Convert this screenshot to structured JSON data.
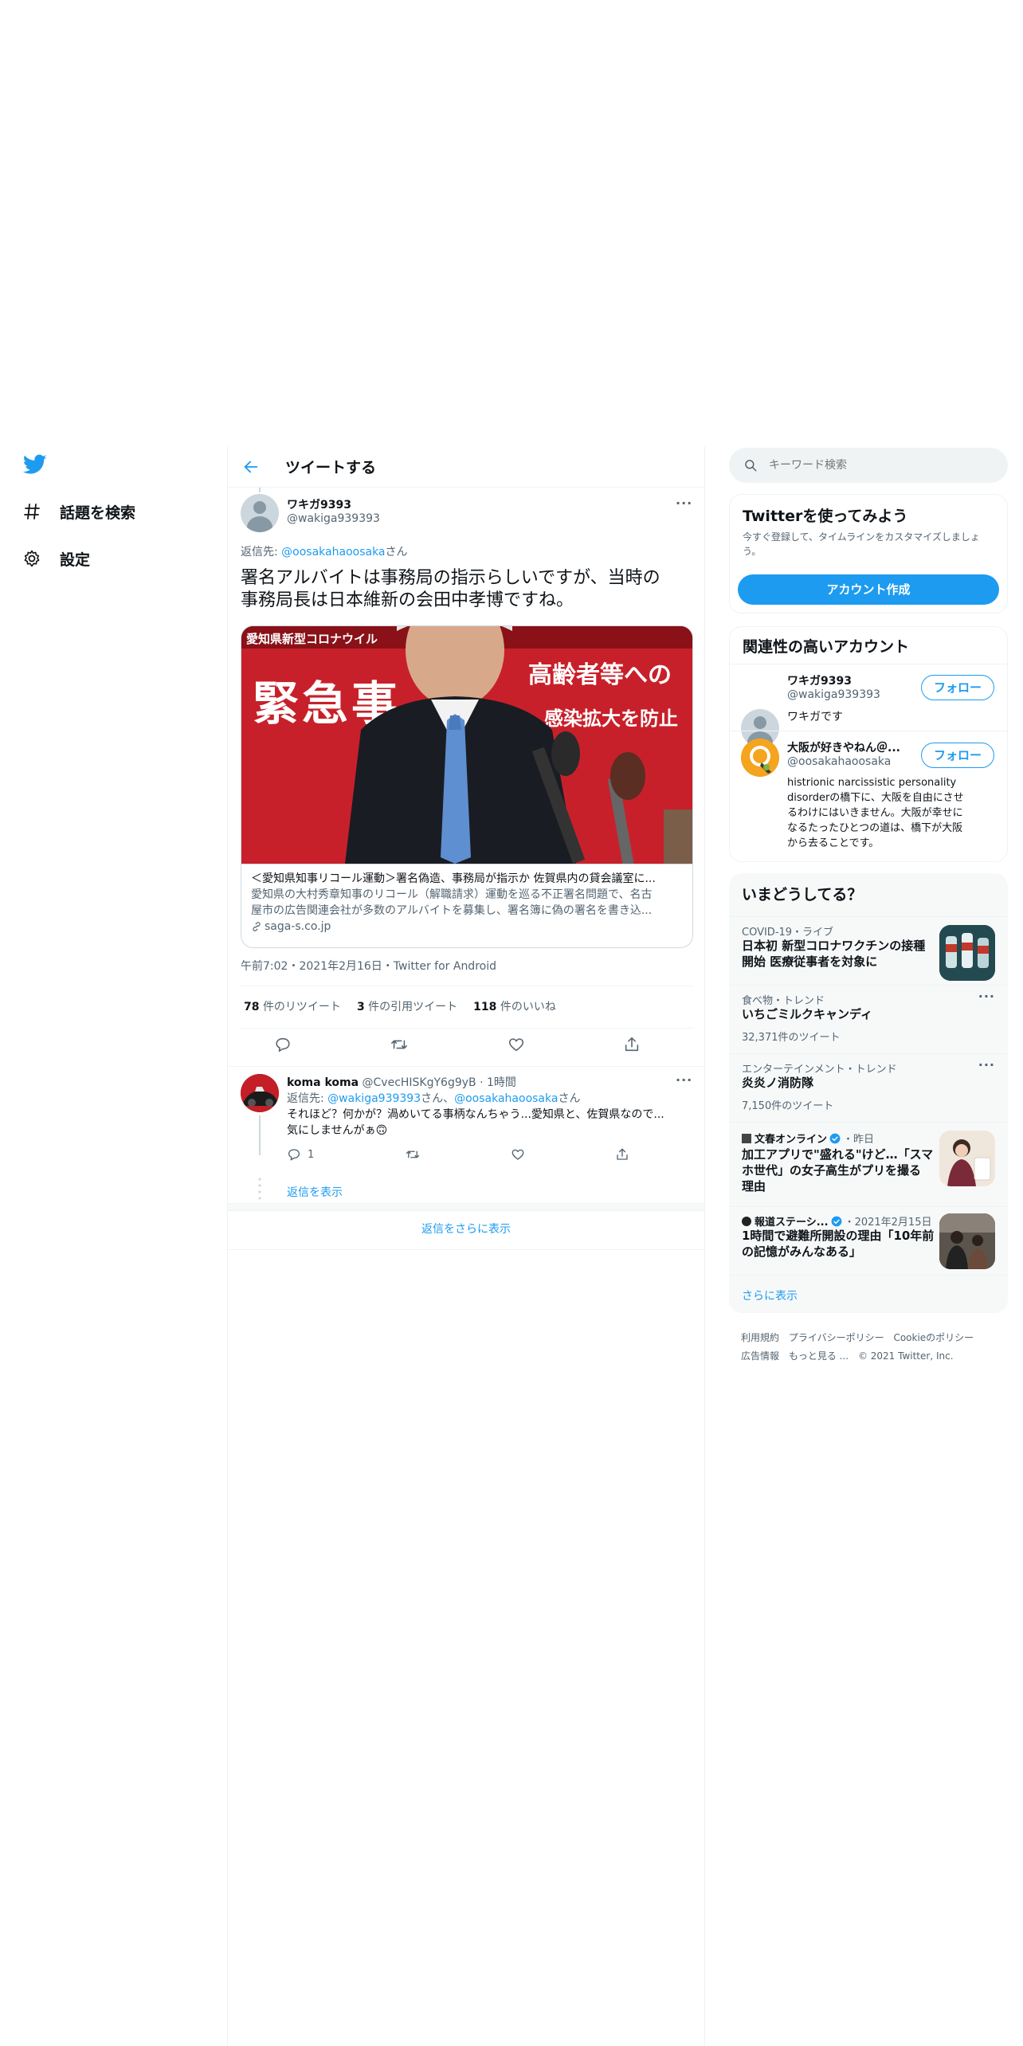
{
  "nav": {
    "items": [
      {
        "label": "話題を検索",
        "icon": "hashtag-icon"
      },
      {
        "label": "設定",
        "icon": "gear-icon"
      }
    ]
  },
  "header": {
    "title": "ツイートする"
  },
  "tweet": {
    "author_name": "ワキガ9393",
    "author_handle": "@wakiga939393",
    "reply_prefix": "返信先: ",
    "reply_to": "@oosakahaoosaka",
    "reply_suffix": "さん",
    "text_line1": "署名アルバイトは事務局の指示らしいですが、当時の",
    "text_line2": "事務局長は日本維新の会田中孝博ですね。",
    "card": {
      "image_text_top": "愛知県新型コロナウイル",
      "image_text_big": "緊急事",
      "image_text_right1": "高齢者等への",
      "image_text_right2": "感染拡大を防止",
      "title": "＜愛知県知事リコール運動＞署名偽造、事務局が指示か 佐賀県内の貸会議室に...",
      "desc_line1": "愛知県の大村秀章知事のリコール（解職請求）運動を巡る不正署名問題で、名古",
      "desc_line2": "屋市の広告関連会社が多数のアルバイトを募集し、署名簿に偽の署名を書き込...",
      "domain": "saga-s.co.jp"
    },
    "timestamp": "午前7:02・2021年2月16日・Twitter for Android",
    "stats": {
      "retweets_count": "78",
      "retweets_label": "件のリツイート",
      "quotes_count": "3",
      "quotes_label": "件の引用ツイート",
      "likes_count": "118",
      "likes_label": "件のいいね"
    }
  },
  "reply": {
    "author_name": "koma koma",
    "author_handle": "@CvecHISKgY6g9yB",
    "time": "1時間",
    "reply_prefix": "返信先: ",
    "reply_to1": "@wakiga939393",
    "reply_mid": "さん、",
    "reply_to2": "@oosakahaoosaka",
    "reply_suffix": "さん",
    "text_line1": "それほど？何かが？渦めいてる事柄なんちゃう...愛知県と、佐賀県なので...",
    "text_line2": "気にしませんがぁ🙃",
    "reply_count": "1",
    "show_replies": "返信を表示"
  },
  "more_replies": "返信をさらに表示",
  "search": {
    "placeholder": "キーワード検索"
  },
  "signup": {
    "title": "Twitterを使ってみよう",
    "desc_line1": "今すぐ登録して、タイムラインをカスタマイズしましょ",
    "desc_line2": "う。",
    "button": "アカウント作成"
  },
  "relevant": {
    "title": "関連性の高いアカウント",
    "follow_label": "フォロー",
    "accounts": [
      {
        "name": "ワキガ9393",
        "handle": "@wakiga939393",
        "bio_lines": [
          "ワキガです"
        ]
      },
      {
        "name": "大阪が好きやねん＠...",
        "handle": "@oosakahaoosaka",
        "bio_lines": [
          "histrionic narcissistic personality",
          "disorderの橋下に、大阪を自由にさせ",
          "るわけにはいきません。大阪が幸せに",
          "なるたったひとつの道は、橋下が大阪",
          "から去ることです。"
        ]
      }
    ]
  },
  "trends": {
    "title": "いまどうしてる？",
    "items": [
      {
        "context": "COVID-19・ライブ",
        "title_lines": [
          "日本初 新型コロナワクチンの接種",
          "開始 医療従事者を対象に"
        ]
      },
      {
        "context": "食べ物・トレンド",
        "title_lines": [
          "いちごミルクキャンディ"
        ],
        "count": "32,371件のツイート"
      },
      {
        "context": "エンターテインメント・トレンド",
        "title_lines": [
          "炎炎ノ消防隊"
        ],
        "count": "7,150件のツイート"
      },
      {
        "context_name": "文春オンライン",
        "context_time": "・昨日",
        "title_lines": [
          "加工アプリで\"盛れる\"けど…「スマ",
          "ホ世代」の女子高生がプリを撮る",
          "理由"
        ]
      },
      {
        "context_name": "報道ステーシ...",
        "context_time": "・2021年2月15日",
        "title_lines": [
          "1時間で避難所開設の理由「10年前",
          "の記憶がみんなある」"
        ]
      }
    ],
    "show_more": "さらに表示"
  },
  "footer": {
    "links_row1": [
      "利用規約",
      "プライバシーポリシー",
      "Cookieのポリシー"
    ],
    "links_row2": [
      "広告情報",
      "もっと見る ..."
    ],
    "copyright": "© 2021 Twitter, Inc."
  },
  "colors": {
    "accent": "#1d9bf0",
    "text": "#0f1419",
    "secondary": "#536471",
    "border": "#eff3f4"
  }
}
